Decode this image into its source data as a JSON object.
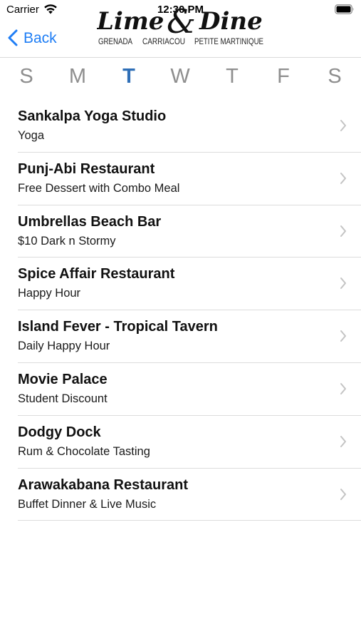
{
  "status_bar": {
    "carrier": "Carrier",
    "time": "12:30 PM",
    "wifi_icon": "wifi-icon",
    "battery_icon": "battery-icon"
  },
  "nav": {
    "back_label": "Back",
    "back_icon": "chevron-left-icon",
    "logo": {
      "word1": "Lime",
      "ampersand": "&",
      "word2": "Dine",
      "locations": [
        "GRENADA",
        "CARRIACOU",
        "PETITE MARTINIQUE"
      ]
    }
  },
  "days": [
    {
      "label": "S",
      "selected": false
    },
    {
      "label": "M",
      "selected": false
    },
    {
      "label": "T",
      "selected": true
    },
    {
      "label": "W",
      "selected": false
    },
    {
      "label": "T",
      "selected": false
    },
    {
      "label": "F",
      "selected": false
    },
    {
      "label": "S",
      "selected": false
    }
  ],
  "listings": [
    {
      "title": "Sankalpa Yoga Studio",
      "subtitle": "Yoga"
    },
    {
      "title": "Punj-Abi Restaurant",
      "subtitle": "Free Dessert with Combo Meal"
    },
    {
      "title": "Umbrellas Beach Bar",
      "subtitle": "$10 Dark n Stormy"
    },
    {
      "title": "Spice Affair Restaurant",
      "subtitle": "Happy Hour"
    },
    {
      "title": "Island Fever - Tropical Tavern",
      "subtitle": "Daily Happy Hour"
    },
    {
      "title": "Movie Palace",
      "subtitle": "Student Discount"
    },
    {
      "title": "Dodgy Dock",
      "subtitle": "Rum & Chocolate Tasting"
    },
    {
      "title": "Arawakabana Restaurant",
      "subtitle": "Buffet Dinner & Live Music"
    }
  ],
  "colors": {
    "accent": "#1f7ef5",
    "selected_day": "#2f6fb7",
    "unselected_day": "#8e8e8e",
    "chevron": "#c4c4c4"
  }
}
